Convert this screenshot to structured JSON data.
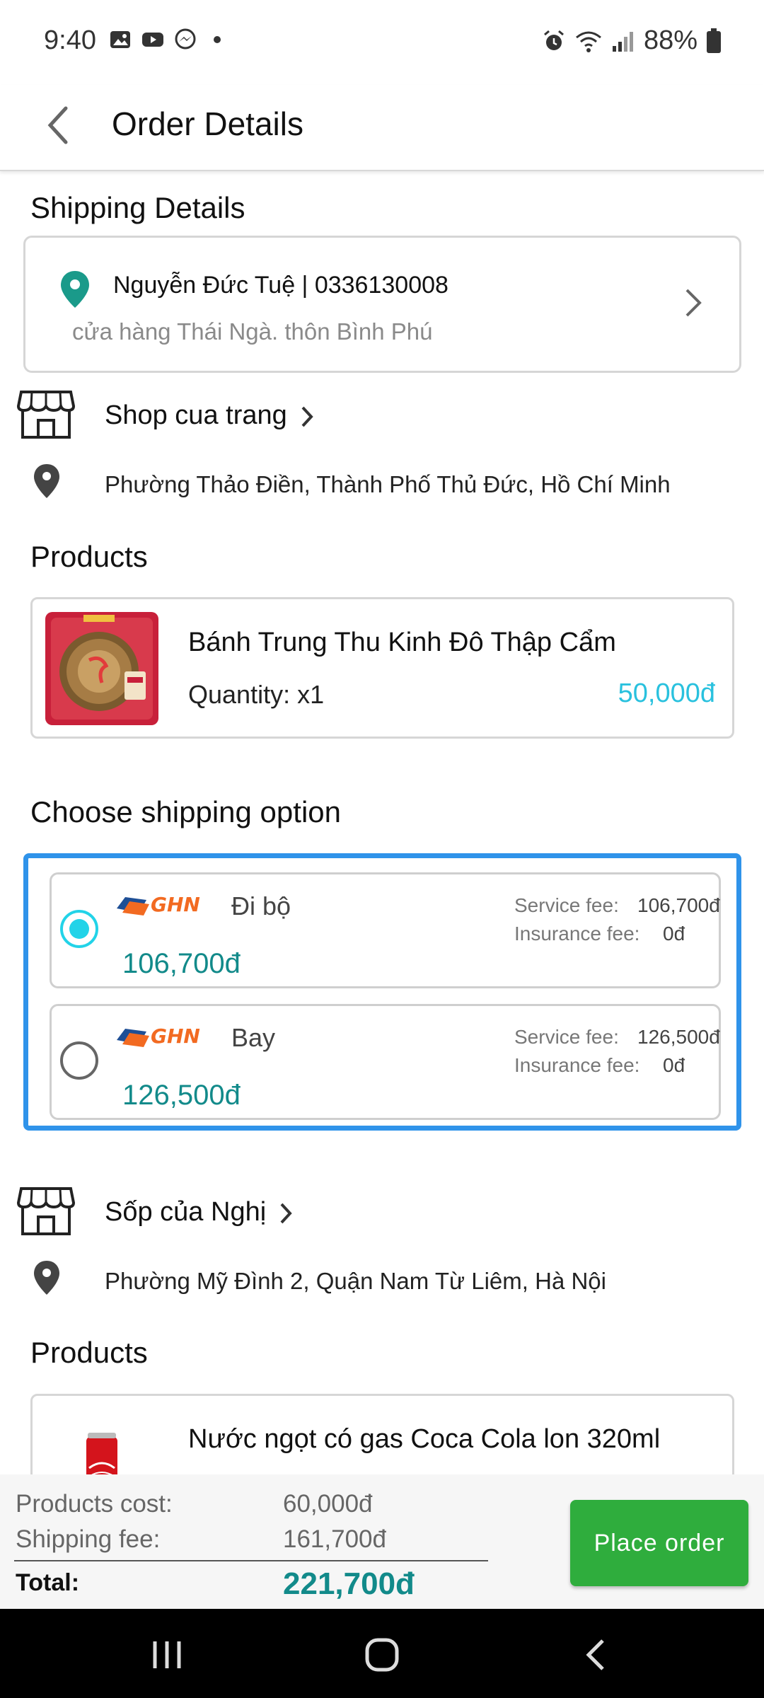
{
  "status_bar": {
    "time": "9:40",
    "battery": "88%"
  },
  "app_bar": {
    "title": "Order Details"
  },
  "shipping_details": {
    "title": "Shipping Details",
    "recipient": "Nguyễn Đức Tuệ | 0336130008",
    "address": "cửa hàng Thái Ngà. thôn Bình Phú"
  },
  "shops": [
    {
      "name": "Shop cua trang",
      "location": "Phường Thảo Điền, Thành Phố Thủ Đức, Hồ Chí Minh",
      "products_title": "Products",
      "product": {
        "name": "Bánh Trung Thu Kinh Đô Thập Cẩm",
        "quantity": "Quantity: x1",
        "price": "50,000đ"
      },
      "shipping": {
        "title": "Choose shipping option",
        "options": [
          {
            "carrier": "GHN",
            "method": "Đi bộ",
            "price": "106,700đ",
            "service_fee_label": "Service fee:",
            "service_fee": "106,700đ",
            "insurance_fee_label": "Insurance fee:",
            "insurance_fee": "0đ",
            "selected": true
          },
          {
            "carrier": "GHN",
            "method": "Bay",
            "price": "126,500đ",
            "service_fee_label": "Service fee:",
            "service_fee": "126,500đ",
            "insurance_fee_label": "Insurance fee:",
            "insurance_fee": "0đ",
            "selected": false
          }
        ]
      }
    },
    {
      "name": "Sốp của Nghị",
      "location": "Phường Mỹ Đình 2, Quận Nam Từ Liêm, Hà Nội",
      "products_title": "Products",
      "product": {
        "name": "Nước ngọt có gas Coca Cola lon 320ml"
      }
    }
  ],
  "summary": {
    "products_cost_label": "Products cost:",
    "products_cost": "60,000đ",
    "shipping_fee_label": "Shipping fee:",
    "shipping_fee": "161,700đ",
    "total_label": "Total:",
    "total": "221,700đ",
    "place_order": "Place order"
  },
  "colors": {
    "accent": "#29c1de",
    "price_green": "#128a8a",
    "button_green": "#2fad3d",
    "selection_border": "#2f93ea"
  }
}
